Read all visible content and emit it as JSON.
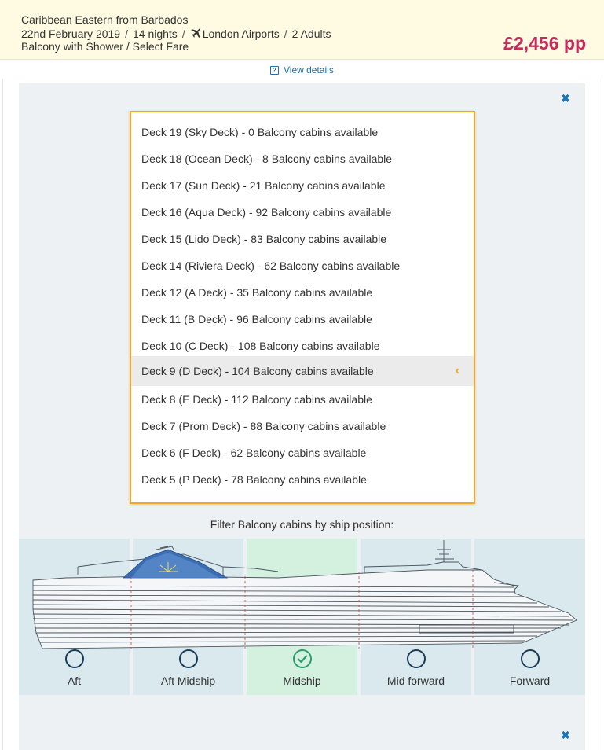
{
  "booking": {
    "cruise_title": "Caribbean Eastern from Barbados",
    "date": "22nd February 2019",
    "nights": "14 nights",
    "airport": "London Airports",
    "passengers": "2 Adults",
    "cabin": "Balcony with Shower / Select Fare",
    "price": "£2,456 pp",
    "separator": "/",
    "view_details": "View details",
    "view_details_icon": "?"
  },
  "deck_selector": {
    "close_icon": "✖",
    "selected_index": 9,
    "selected_indicator": "‹",
    "decks": [
      "Deck 19 (Sky Deck) - 0 Balcony cabins available",
      "Deck 18 (Ocean Deck) - 8 Balcony cabins available",
      "Deck 17 (Sun Deck) - 21 Balcony cabins available",
      "Deck 16 (Aqua Deck) - 92 Balcony cabins available",
      "Deck 15 (Lido Deck) - 83 Balcony cabins available",
      "Deck 14 (Riviera Deck) - 62 Balcony cabins available",
      "Deck 12 (A Deck) - 35 Balcony cabins available",
      "Deck 11 (B Deck) - 96 Balcony cabins available",
      "Deck 10 (C Deck) - 108 Balcony cabins available",
      "Deck 9 (D Deck) - 104 Balcony cabins available",
      "Deck 8 (E Deck) - 112 Balcony cabins available",
      "Deck 7 (Prom Deck) - 88 Balcony cabins available",
      "Deck 6 (F Deck) - 62 Balcony cabins available",
      "Deck 5 (P Deck) - 78 Balcony cabins available"
    ]
  },
  "ship_position": {
    "label": "Filter Balcony cabins by ship position:",
    "positions": [
      "Aft",
      "Aft Midship",
      "Midship",
      "Mid forward",
      "Forward"
    ],
    "selected": "Midship",
    "check_icon": "✓"
  },
  "colors": {
    "price": "#c8285c",
    "accent_border": "#f2a623",
    "link": "#1f6fb2",
    "selected_zone": "#d4f1e0",
    "zone": "#d9e9ee",
    "check": "#2a9d6a"
  }
}
